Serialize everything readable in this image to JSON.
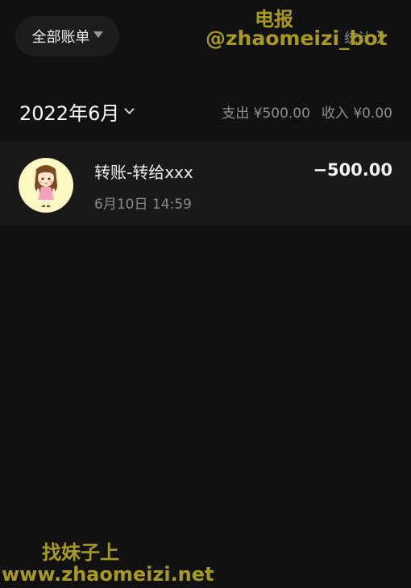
{
  "header": {
    "filter_label": "全部账单",
    "stats_label": "统计"
  },
  "watermark": {
    "top_line1": "电报",
    "top_line2": "@zhaomeizi_bot",
    "bottom_line1": "找妹子上",
    "bottom_line2": "www.zhaomeizi.net"
  },
  "month": {
    "label": "2022年6月",
    "expense": "支出 ¥500.00",
    "income": "收入 ¥0.00"
  },
  "transactions": [
    {
      "title": "转账-转给xxx",
      "time": "6月10日 14:59",
      "amount": "−500.00",
      "avatar_icon": "cartoon-girl-avatar"
    }
  ],
  "colors": {
    "background": "#111111",
    "row_background": "#191919",
    "pill_background": "#1d1d1d",
    "watermark": "#a79a1e",
    "avatar_background": "#fff9c4"
  }
}
